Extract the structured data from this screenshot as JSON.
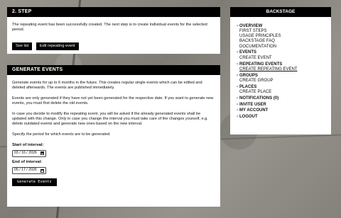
{
  "step_panel": {
    "title": "2. STEP",
    "message": "The repeating event has been successfully created. The next step is to create individual events for the selected period.",
    "buttons": [
      "See list",
      "Edit repeating event"
    ]
  },
  "events_panel": {
    "title": "GENERATE EVENTS",
    "paragraphs": [
      "Generate events for up to 6 months in the future. This creates regular single events which can be edited and deleted afterwards. The events are published immediately.",
      "Events are only generated if they have not yet been generated for the respective date. If you want to generate new events, you must first delete the old events.",
      "In case you decide to modify the repeating event, you will be asked if the already generated events shall be updated with this change. Only in case you change the interval you must take care of the changes yourself, e.g. delete outdated events and generate new ones based on the new interval.",
      "Specify the period for which events are to be generated."
    ],
    "start_label": "Start of interval:",
    "start_value": "03 / 16 / 2026",
    "end_label": "End of interval:",
    "end_value": "05 / 17 / 2026",
    "submit_label": "Generate Events"
  },
  "backstage": {
    "title": "BACKSTAGE",
    "sections": [
      {
        "label": "OVERVIEW",
        "items": [
          "FIRST STEPS",
          "USAGE PRINCIPLES",
          "BACKSTAGE FAQ",
          "DOCUMENTATION"
        ]
      },
      {
        "label": "EVENTS",
        "items": [
          "CREATE EVENT"
        ]
      },
      {
        "label": "REPEATING EVENTS",
        "items": [
          "CREATE REPEATING EVENT"
        ]
      },
      {
        "label": "GROUPS",
        "items": [
          "CREATE GROUP"
        ]
      },
      {
        "label": "PLACES",
        "items": [
          "CREATE PLACE"
        ]
      },
      {
        "label": "NOTIFICATIONS (0)",
        "items": []
      },
      {
        "label": "INVITE USER",
        "items": []
      },
      {
        "label": "MY ACCOUNT",
        "items": []
      },
      {
        "label": "LOGOUT",
        "items": []
      }
    ]
  }
}
